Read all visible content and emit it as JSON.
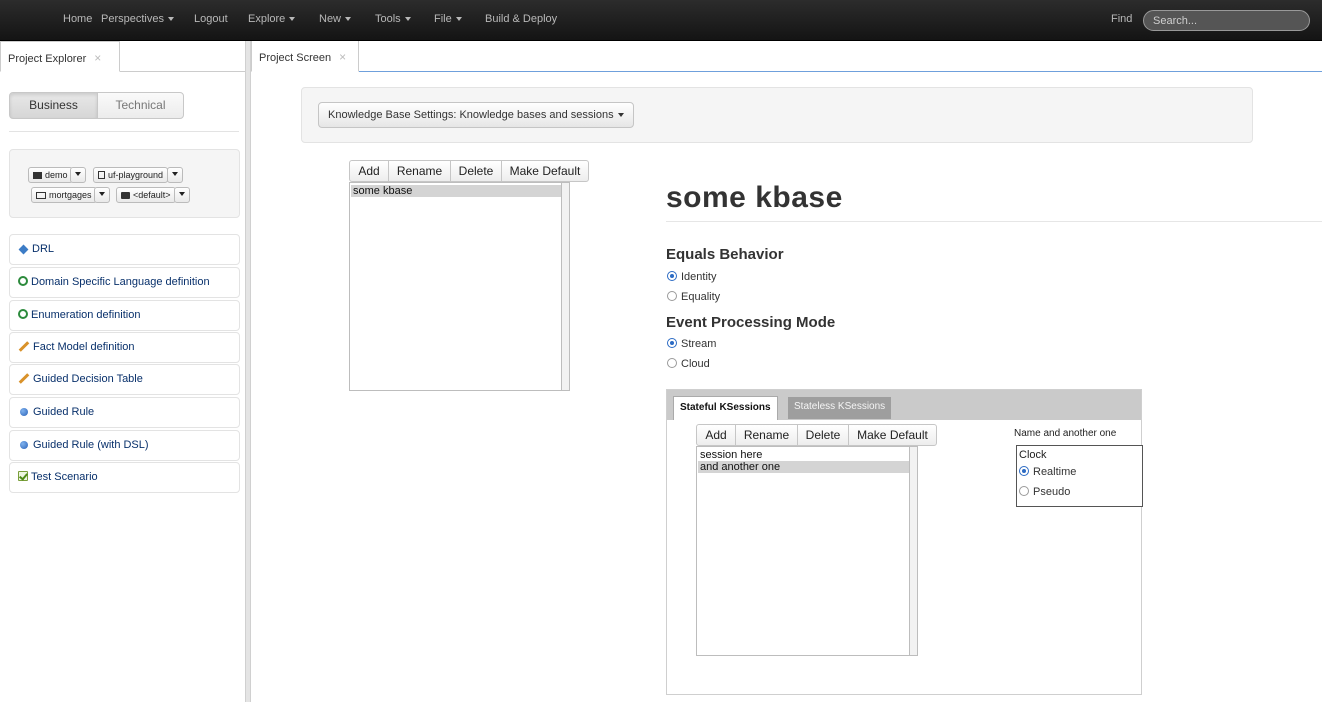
{
  "topnav": {
    "items": [
      {
        "label": "Home",
        "caret": false
      },
      {
        "label": "Perspectives",
        "caret": true
      },
      {
        "label": "Logout",
        "caret": false
      },
      {
        "label": "Explore",
        "caret": true
      },
      {
        "label": "New",
        "caret": true
      },
      {
        "label": "Tools",
        "caret": true
      },
      {
        "label": "File",
        "caret": true
      },
      {
        "label": "Build & Deploy",
        "caret": false
      }
    ],
    "find_label": "Find",
    "search_placeholder": "Search..."
  },
  "left_panel": {
    "tab_label": "Project Explorer",
    "view_toggle": {
      "business": "Business",
      "technical": "Technical",
      "active": "business"
    },
    "context": {
      "organizational_unit": "demo",
      "repository": "uf-playground",
      "project": "mortgages",
      "package": "<default>"
    },
    "asset_types": [
      {
        "label": "DRL",
        "icon": "diamond-icon"
      },
      {
        "label": "Domain Specific Language definition",
        "icon": "plus-circle-icon"
      },
      {
        "label": "Enumeration definition",
        "icon": "plus-circle-icon"
      },
      {
        "label": "Fact Model definition",
        "icon": "pencil-icon"
      },
      {
        "label": "Guided Decision Table",
        "icon": "pencil-icon"
      },
      {
        "label": "Guided Rule",
        "icon": "blue-dot-icon"
      },
      {
        "label": "Guided Rule (with DSL)",
        "icon": "blue-dot-icon"
      },
      {
        "label": "Test Scenario",
        "icon": "checkbox-icon"
      }
    ]
  },
  "right_panel": {
    "tab_label": "Project Screen",
    "settings_dropdown": "Knowledge Base Settings: Knowledge bases and sessions",
    "kbase_toolbar": {
      "add": "Add",
      "rename": "Rename",
      "delete": "Delete",
      "make_default": "Make Default"
    },
    "kbase_list": [
      {
        "label": "some kbase",
        "selected": true
      }
    ],
    "kbase_title": "some kbase",
    "equals_behavior": {
      "heading": "Equals Behavior",
      "options": [
        {
          "label": "Identity",
          "checked": true
        },
        {
          "label": "Equality",
          "checked": false
        }
      ]
    },
    "event_processing": {
      "heading": "Event Processing Mode",
      "options": [
        {
          "label": "Stream",
          "checked": true
        },
        {
          "label": "Cloud",
          "checked": false
        }
      ]
    },
    "ksessions": {
      "tabs": [
        {
          "label": "Stateful KSessions",
          "active": true
        },
        {
          "label": "Stateless KSessions",
          "active": false
        }
      ],
      "toolbar": {
        "add": "Add",
        "rename": "Rename",
        "delete": "Delete",
        "make_default": "Make Default"
      },
      "list": [
        {
          "label": "session here",
          "selected": false
        },
        {
          "label": "and another one",
          "selected": true
        }
      ],
      "selected_name": "Name and another one",
      "clock": {
        "label": "Clock",
        "options": [
          {
            "label": "Realtime",
            "checked": true
          },
          {
            "label": "Pseudo",
            "checked": false
          }
        ]
      }
    }
  }
}
